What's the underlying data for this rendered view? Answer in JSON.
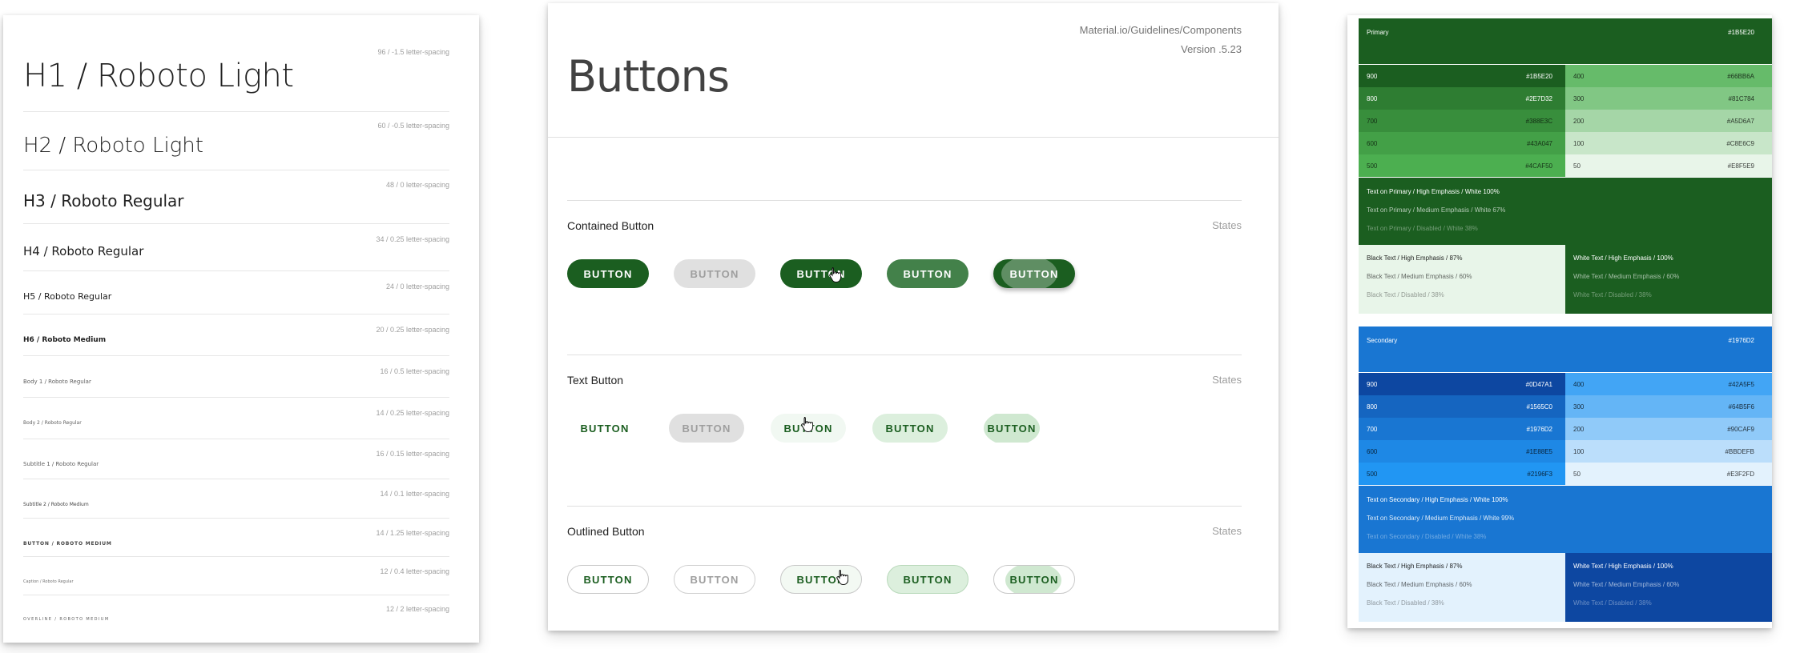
{
  "typography": {
    "rows": [
      {
        "name": "H1 / Roboto Light",
        "meta": "96 / -1.5 letter-spacing"
      },
      {
        "name": "H2 / Roboto Light",
        "meta": "60 / -0.5 letter-spacing"
      },
      {
        "name": "H3 / Roboto Regular",
        "meta": "48 / 0 letter-spacing"
      },
      {
        "name": "H4 / Roboto Regular",
        "meta": "34 / 0.25 letter-spacing"
      },
      {
        "name": "H5 / Roboto Regular",
        "meta": "24 / 0 letter-spacing"
      },
      {
        "name": "H6 / Roboto Medium",
        "meta": "20 / 0.25 letter-spacing"
      },
      {
        "name": "Body 1 / Roboto Regular",
        "meta": "16 / 0.5 letter-spacing"
      },
      {
        "name": "Body 2 / Roboto Regular",
        "meta": "14 / 0.25 letter-spacing"
      },
      {
        "name": "Subtitle 1 / Roboto Regular",
        "meta": "16 / 0.15 letter-spacing"
      },
      {
        "name": "Subtitle 2 / Roboto Medium",
        "meta": "14 / 0.1 letter-spacing"
      },
      {
        "name": "BUTTON / ROBOTO MEDIUM",
        "meta": "14 / 1.25 letter-spacing"
      },
      {
        "name": "Caption / Roboto Regular",
        "meta": "12 / 0.4 letter-spacing"
      },
      {
        "name": "OVERLINE / ROBOTO MEDIUM",
        "meta": "12 / 2 letter-spacing"
      }
    ]
  },
  "buttons_page": {
    "title": "Buttons",
    "source": "Material.io/Guidelines/Components",
    "version": "Version .5.23",
    "sections": [
      {
        "title": "Contained Button",
        "states_label": "States",
        "label": "BUTTON"
      },
      {
        "title": "Text Button",
        "states_label": "States",
        "label": "BUTTON"
      },
      {
        "title": "Outlined Button",
        "states_label": "States",
        "label": "BUTTON"
      }
    ],
    "cursor_icon": "hand-pointer-icon"
  },
  "colors": {
    "primary": {
      "header_label": "Primary",
      "header_hex": "#1B5E20",
      "shades_left": [
        {
          "name": "900",
          "hex": "#1B5E20",
          "bg": "#1B5E20"
        },
        {
          "name": "800",
          "hex": "#2E7D32",
          "bg": "#2E7D32"
        },
        {
          "name": "700",
          "hex": "#388E3C",
          "bg": "#388E3C"
        },
        {
          "name": "600",
          "hex": "#43A047",
          "bg": "#43A047"
        },
        {
          "name": "500",
          "hex": "#4CAF50",
          "bg": "#4CAF50"
        }
      ],
      "shades_right": [
        {
          "name": "400",
          "hex": "#66BB6A",
          "bg": "#66BB6A"
        },
        {
          "name": "300",
          "hex": "#81C784",
          "bg": "#81C784"
        },
        {
          "name": "200",
          "hex": "#A5D6A7",
          "bg": "#A5D6A7"
        },
        {
          "name": "100",
          "hex": "#C8E6C9",
          "bg": "#C8E6C9"
        },
        {
          "name": "50",
          "hex": "#E8F5E9",
          "bg": "#E8F5E9"
        }
      ],
      "on_color": [
        "Text on Primary / High Emphasis / White 100%",
        "Text on Primary / Medium Emphasis / White 67%",
        "Text on Primary / Disabled / White 38%"
      ],
      "black_text": [
        "Black Text / High Emphasis / 87%",
        "Black Text / Medium Emphasis / 60%",
        "Black Text / Disabled / 38%"
      ],
      "white_text": [
        "White Text / High Emphasis / 100%",
        "White Text / Medium Emphasis / 60%",
        "White Text / Disabled / 38%"
      ]
    },
    "secondary": {
      "header_label": "Secondary",
      "header_hex": "#1976D2",
      "shades_left": [
        {
          "name": "900",
          "hex": "#0D47A1",
          "bg": "#0D47A1"
        },
        {
          "name": "800",
          "hex": "#1565C0",
          "bg": "#1565C0"
        },
        {
          "name": "700",
          "hex": "#1976D2",
          "bg": "#1976D2"
        },
        {
          "name": "600",
          "hex": "#1E88E5",
          "bg": "#1E88E5"
        },
        {
          "name": "500",
          "hex": "#2196F3",
          "bg": "#2196F3"
        }
      ],
      "shades_right": [
        {
          "name": "400",
          "hex": "#42A5F5",
          "bg": "#42A5F5"
        },
        {
          "name": "300",
          "hex": "#64B5F6",
          "bg": "#64B5F6"
        },
        {
          "name": "200",
          "hex": "#90CAF9",
          "bg": "#90CAF9"
        },
        {
          "name": "100",
          "hex": "#BBDEFB",
          "bg": "#BBDEFB"
        },
        {
          "name": "50",
          "hex": "#E3F2FD",
          "bg": "#E3F2FD"
        }
      ],
      "on_color": [
        "Text on Secondary / High Emphasis / White 100%",
        "Text on Secondary / Medium Emphasis / White 99%",
        "Text on Secondary / Disabled / White 38%"
      ],
      "black_text": [
        "Black Text / High Emphasis / 87%",
        "Black Text / Medium Emphasis / 60%",
        "Black Text / Disabled / 38%"
      ],
      "white_text": [
        "White Text / High Emphasis / 100%",
        "White Text / Medium Emphasis / 60%",
        "White Text / Disabled / 38%"
      ]
    }
  }
}
